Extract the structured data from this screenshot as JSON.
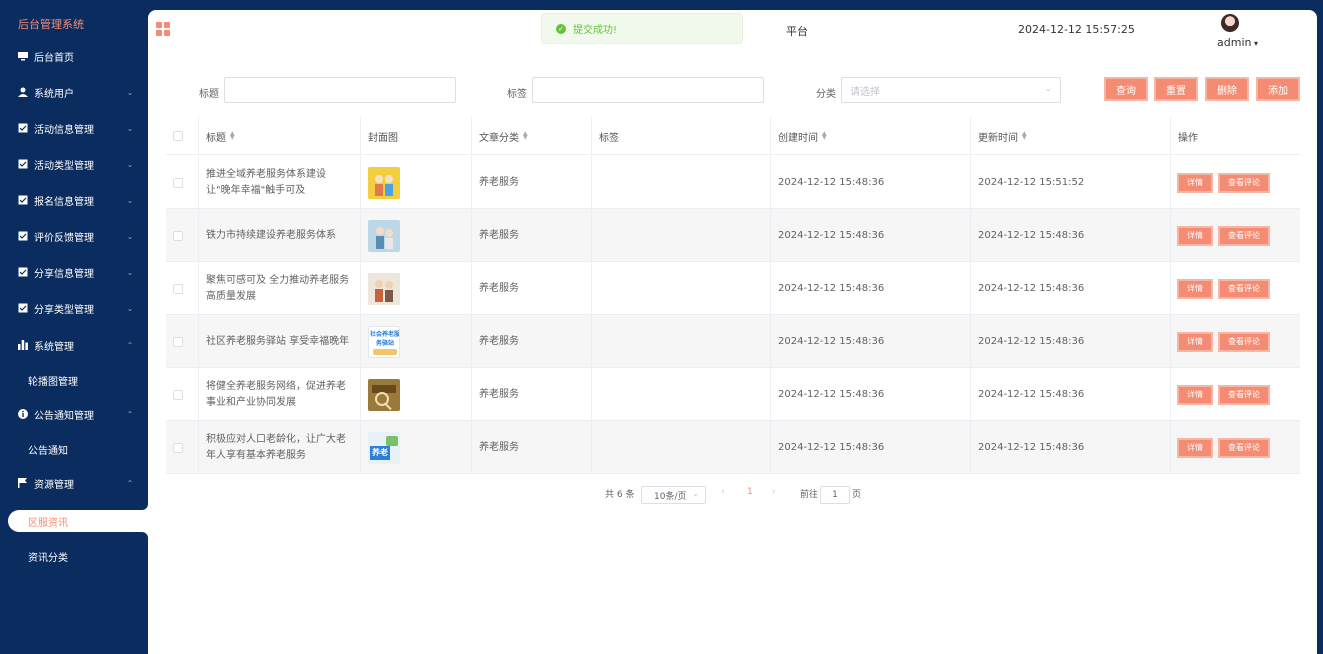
{
  "sidebar": {
    "title": "后台管理系统",
    "items": [
      {
        "label": "后台首页"
      },
      {
        "label": "系统用户"
      },
      {
        "label": "活动信息管理"
      },
      {
        "label": "活动类型管理"
      },
      {
        "label": "报名信息管理"
      },
      {
        "label": "评价反馈管理"
      },
      {
        "label": "分享信息管理"
      },
      {
        "label": "分享类型管理"
      },
      {
        "label": "系统管理"
      },
      {
        "label": "公告通知管理"
      },
      {
        "label": "资源管理"
      }
    ],
    "subitems": {
      "carousel": "轮播图管理",
      "notice": "公告通知",
      "news": "区服资讯",
      "news_category": "资讯分类"
    }
  },
  "header": {
    "title_fragment": "平台",
    "datetime": "2024-12-12 15:57:25",
    "user": "admin"
  },
  "toast": {
    "message": "提交成功!"
  },
  "search": {
    "title_label": "标题",
    "tag_label": "标签",
    "category_label": "分类",
    "category_placeholder": "请选择",
    "buttons": {
      "query": "查询",
      "reset": "重置",
      "delete": "删除",
      "add": "添加"
    }
  },
  "table": {
    "headers": {
      "title": "标题",
      "cover": "封面图",
      "category": "文章分类",
      "tags": "标签",
      "created": "创建时间",
      "updated": "更新时间",
      "actions": "操作"
    },
    "rows": [
      {
        "title": "推进全域养老服务体系建设 让\"晚年幸福\"触手可及",
        "category": "养老服务",
        "tags": "",
        "created": "2024-12-12 15:48:36",
        "updated": "2024-12-12 15:51:52"
      },
      {
        "title": "铁力市持续建设养老服务体系",
        "category": "养老服务",
        "tags": "",
        "created": "2024-12-12 15:48:36",
        "updated": "2024-12-12 15:48:36"
      },
      {
        "title": "聚焦可感可及 全力推动养老服务高质量发展",
        "category": "养老服务",
        "tags": "",
        "created": "2024-12-12 15:48:36",
        "updated": "2024-12-12 15:48:36"
      },
      {
        "title": "社区养老服务驿站 享受幸福晚年",
        "category": "养老服务",
        "tags": "",
        "created": "2024-12-12 15:48:36",
        "updated": "2024-12-12 15:48:36"
      },
      {
        "title": "将健全养老服务网络，促进养老事业和产业协同发展",
        "category": "养老服务",
        "tags": "",
        "created": "2024-12-12 15:48:36",
        "updated": "2024-12-12 15:48:36"
      },
      {
        "title": "积极应对人口老龄化，让广大老年人享有基本养老服务",
        "category": "养老服务",
        "tags": "",
        "created": "2024-12-12 15:48:36",
        "updated": "2024-12-12 15:48:36"
      }
    ],
    "row_actions": {
      "detail": "详情",
      "comments": "查看评论"
    },
    "thumb_texts": {
      "row4": "社会养老服务驿站",
      "row6": "养老"
    }
  },
  "pagination": {
    "total": "共 6 条",
    "page_size": "10条/页",
    "current": "1",
    "goto_prefix": "前往",
    "goto_value": "1",
    "goto_suffix": "页"
  },
  "colors": {
    "accent": "#f48c74",
    "sidebar": "#0b2c5f",
    "success": "#67c23a"
  }
}
